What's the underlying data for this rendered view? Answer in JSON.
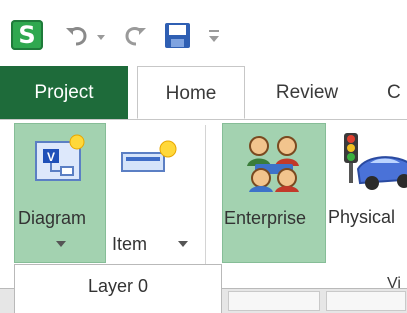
{
  "quick_access": {
    "app_logo_letter": "S",
    "icons": [
      "app-logo-icon",
      "undo-icon",
      "dropdown-arrow-icon",
      "redo-icon",
      "save-icon",
      "customize-icon"
    ]
  },
  "tabs": [
    {
      "label": "Project",
      "active": false
    },
    {
      "label": "Home",
      "active": true
    },
    {
      "label": "Review",
      "active": false
    },
    {
      "label": "C",
      "active": false
    }
  ],
  "ribbon": {
    "buttons": [
      {
        "label": "Diagram",
        "icon": "diagram-icon",
        "has_dropdown": true,
        "highlighted": true
      },
      {
        "label": "Item",
        "icon": "item-icon",
        "has_dropdown": true,
        "highlighted": false
      },
      {
        "label": "Enterprise",
        "icon": "enterprise-icon",
        "has_dropdown": false,
        "highlighted": true
      },
      {
        "label": "Physical",
        "icon": "physical-icon",
        "has_dropdown": false,
        "highlighted": false
      }
    ],
    "group_label": "Vi"
  },
  "dropdown": {
    "items": [
      {
        "label": "Layer 0"
      }
    ]
  },
  "colors": {
    "project_tab": "#1e6b3a",
    "highlight": "#a3d2b0",
    "app_logo": "#2fa84f"
  }
}
